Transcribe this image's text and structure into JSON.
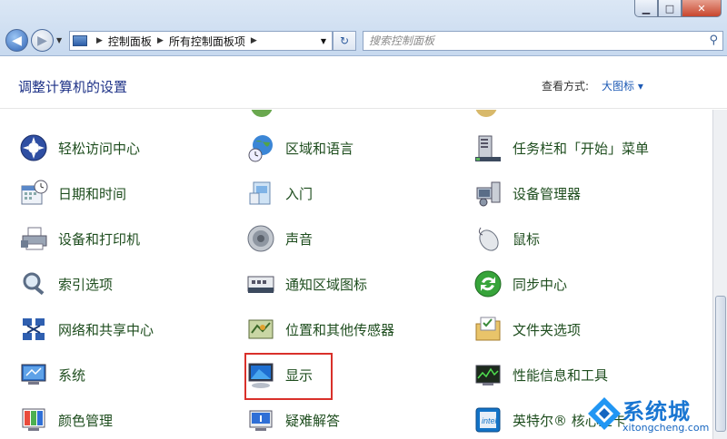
{
  "nav": {
    "breadcrumbs": [
      "控制面板",
      "所有控制面板项"
    ],
    "search_placeholder": "搜索控制面板"
  },
  "header": {
    "title": "调整计算机的设置",
    "view_label": "查看方式:",
    "view_value": "大图标 ▾"
  },
  "items": [
    {
      "label": "轻松访问中心",
      "icon": "ease-of-access-icon"
    },
    {
      "label": "区域和语言",
      "icon": "globe-clock-icon"
    },
    {
      "label": "任务栏和「开始」菜单",
      "icon": "taskbar-icon"
    },
    {
      "label": "日期和时间",
      "icon": "calendar-clock-icon"
    },
    {
      "label": "入门",
      "icon": "getting-started-icon"
    },
    {
      "label": "设备管理器",
      "icon": "device-manager-icon"
    },
    {
      "label": "设备和打印机",
      "icon": "printer-icon"
    },
    {
      "label": "声音",
      "icon": "speaker-icon"
    },
    {
      "label": "鼠标",
      "icon": "mouse-icon"
    },
    {
      "label": "索引选项",
      "icon": "magnifier-icon"
    },
    {
      "label": "通知区域图标",
      "icon": "notification-area-icon"
    },
    {
      "label": "同步中心",
      "icon": "sync-icon"
    },
    {
      "label": "网络和共享中心",
      "icon": "network-icon"
    },
    {
      "label": "位置和其他传感器",
      "icon": "location-sensor-icon"
    },
    {
      "label": "文件夹选项",
      "icon": "folder-options-icon"
    },
    {
      "label": "系统",
      "icon": "system-icon"
    },
    {
      "label": "显示",
      "icon": "display-icon"
    },
    {
      "label": "性能信息和工具",
      "icon": "performance-icon"
    },
    {
      "label": "颜色管理",
      "icon": "color-management-icon"
    },
    {
      "label": "疑难解答",
      "icon": "troubleshooting-icon"
    },
    {
      "label": "英特尔® 核心显卡",
      "icon": "intel-graphics-icon"
    }
  ],
  "watermark": {
    "text": "系统城",
    "url": "xitongcheng.com"
  },
  "colors": {
    "item_text": "#1e4d1e",
    "heading": "#1e3287",
    "highlight": "#d9302a",
    "watermark": "#1976d2"
  }
}
